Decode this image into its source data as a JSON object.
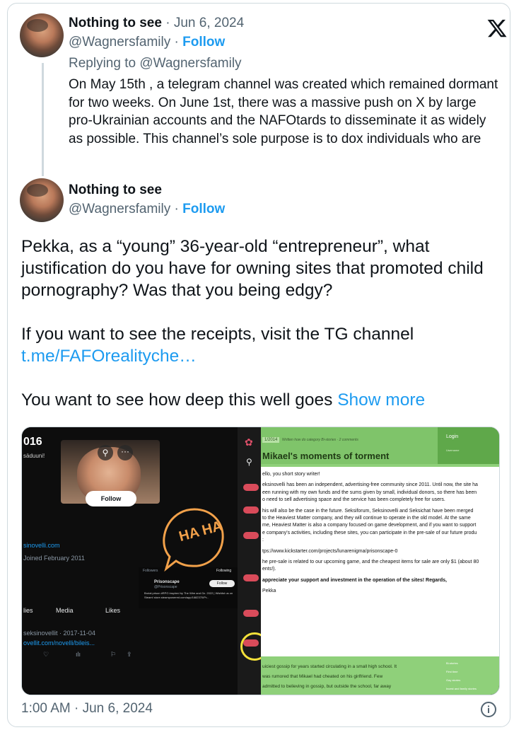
{
  "quoted": {
    "name": "Nothing to see",
    "date": "Jun 6, 2024",
    "handle": "@Wagnersfamily",
    "follow": "Follow",
    "replying_to": "Replying to @Wagnersfamily",
    "text": "On May 15th , a telegram channel was created which remained dormant for two weeks. On June 1st, there was a massive push on X by large pro-Ukrainian accounts and the NAFOtards to disseminate it as widely as possible. This channel’s sole purpose is to dox individuals who are"
  },
  "tweet": {
    "name": "Nothing to see",
    "handle": "@Wagnersfamily",
    "follow": "Follow",
    "para1": "Pekka, as a “young” 36-year-old “entrepreneur”, what justification do you have for owning sites that promoted child pornography? Was that you being edgy?",
    "para2": "If you want to see the receipts, visit the TG channel",
    "link": "t.me/FAFOrealityche…",
    "para3": "You want to see how deep this well goes",
    "show_more": "Show more",
    "timestamp": "1:00 AM · Jun 6, 2024"
  },
  "media_left": {
    "header_partial": "016",
    "subtitle_partial": "säduuni!",
    "follow_btn": "Follow",
    "site": "sinovelli.com",
    "joined": "Joined February 2011",
    "tabs": [
      "lies",
      "Media",
      "Likes"
    ],
    "post_handle": "seksinovellit · 2017-11-04",
    "post_link": "ovellit.com/novelli/bileis...",
    "haha": "HA HA",
    "overlay_tabs": [
      "Followers",
      "Following"
    ],
    "overlay_name": "Prisonscape",
    "overlay_handle": "@Prisonscape",
    "overlay_follow": "Follow",
    "overlay_bio": "Brutal prison #RPG inspired by The Wire and Oz. 2022 | Wishlist us on Steam! store.steampowered.com/app/1682370/Pr..."
  },
  "media_right": {
    "date_tag": "1/2014",
    "meta_line": "Written how do category Bi-stories · 2 comments",
    "title": "Mikael's moments of torment",
    "login": "Login",
    "username_label": "Username",
    "lines": [
      "ello, you short story writer!",
      "eksinovelli has been an independent, advertising-free community since 2011. Until now, the site ha",
      "een running with my own funds and the sums given by small, individual donors, so there has been",
      "o need to sell advertising space and the service has been completely free for users.",
      "his will also be the case in the future. Seksiforum, Seksinovelli and Seksichat have been merged",
      "to the Heaviest Matter company, and they will continue to operate in the old model. At the same",
      "me, Heaviest Matter is also a company focused on game development, and if you want to support",
      "e company's activities, including these sites, you can participate in the pre-sale of our future produ",
      ":",
      "tps://www.kickstarter.com/projects/lunarenigma/prisonscape-0",
      "he pre-sale is related to our upcoming game, and the cheapest items for sale are only $1 (about 80",
      "ents!).",
      "appreciate your support and investment in the operation of the sites! Regards,",
      "Pekka"
    ],
    "bottom_lines": [
      "uiciest gossip for years started circulating in a small high school. It",
      "was rumored that Mikael had cheated on his girlfriend. Few",
      "admitted to believing in gossip, but outside the school, far away"
    ],
    "side_links": [
      "Bi-stories",
      "First time",
      "Gay stories",
      "Incest and family stories"
    ]
  },
  "colors": {
    "link": "#1d9bf0",
    "muted": "#536471",
    "text": "#0f1419",
    "border": "#cfd9de",
    "green": "#8fd07a"
  }
}
